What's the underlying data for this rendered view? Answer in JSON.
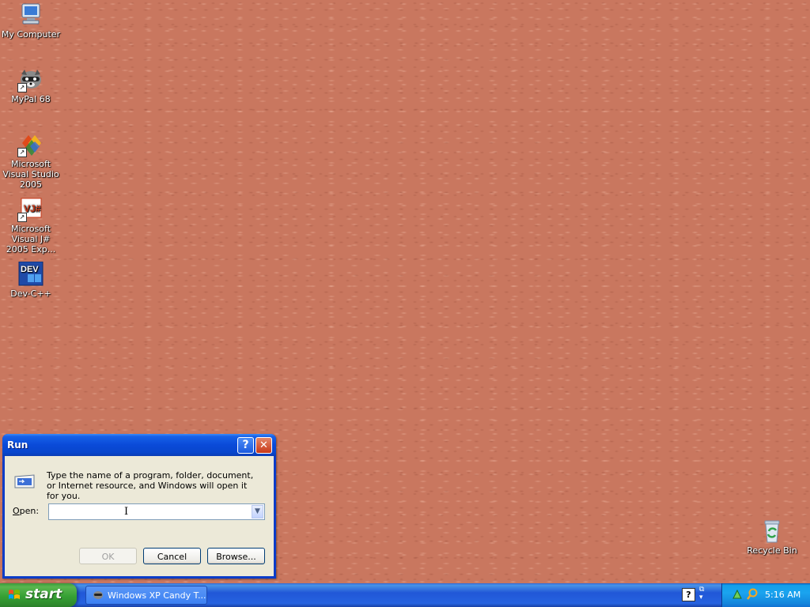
{
  "desktop": {
    "icons": [
      {
        "label": "My Computer",
        "icon": "computer-icon"
      },
      {
        "label": "MyPal 68",
        "icon": "raccoon-icon"
      },
      {
        "label": "Microsoft Visual Studio 2005",
        "icon": "visual-studio-icon"
      },
      {
        "label": "Microsoft Visual J# 2005 Exp...",
        "icon": "vj-sharp-icon"
      },
      {
        "label": "Dev-C++",
        "icon": "dev-cpp-icon"
      }
    ],
    "recycle_bin": {
      "label": "Recycle Bin",
      "icon": "recycle-bin-icon"
    }
  },
  "run_dialog": {
    "title": "Run",
    "help_button": "?",
    "close_button": "✕",
    "prompt": "Type the name of a program, folder, document, or Internet resource, and Windows will open it for you.",
    "open_label_prefix": "",
    "open_label_underlined": "O",
    "open_label_rest": "pen:",
    "open_value": "",
    "buttons": {
      "ok": "OK",
      "cancel": "Cancel",
      "browse": "Browse..."
    }
  },
  "taskbar": {
    "start_label": "start",
    "task_button": "Windows XP Candy T...",
    "help_tray": "?",
    "clock": "5:16 AM"
  },
  "colors": {
    "desktop": "#c9775f",
    "titlebar": "#0a4ad8",
    "taskbar": "#2157d7",
    "start": "#36a034"
  }
}
